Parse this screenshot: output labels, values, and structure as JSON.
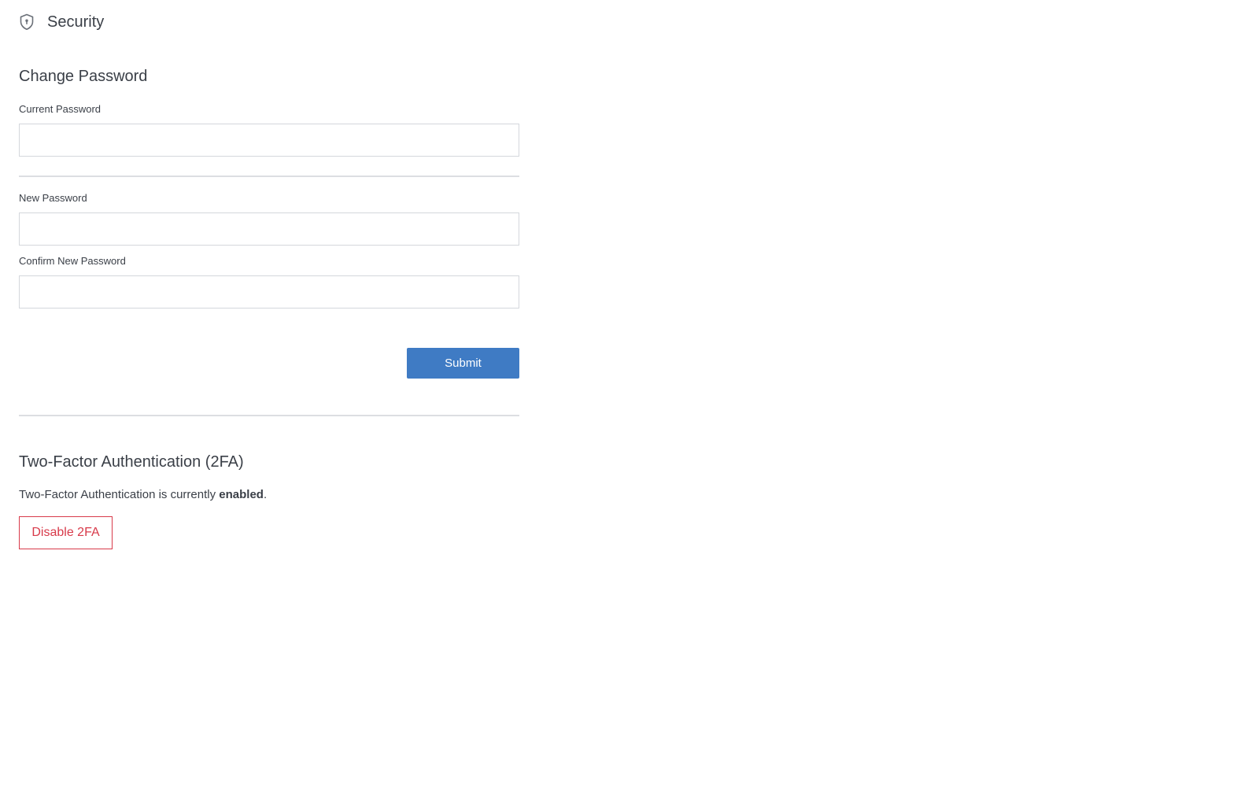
{
  "header": {
    "icon": "shield-icon",
    "title": "Security"
  },
  "change_password": {
    "title": "Change Password",
    "current_password": {
      "label": "Current Password",
      "value": "",
      "placeholder": ""
    },
    "new_password": {
      "label": "New Password",
      "value": "",
      "placeholder": ""
    },
    "confirm_password": {
      "label": "Confirm New Password",
      "value": "",
      "placeholder": ""
    },
    "submit_label": "Submit"
  },
  "two_factor": {
    "title": "Two-Factor Authentication (2FA)",
    "status_prefix": "Two-Factor Authentication is currently ",
    "status_value": "enabled",
    "status_suffix": ".",
    "disable_label": "Disable 2FA"
  },
  "colors": {
    "primary": "#3f7bc4",
    "danger": "#d83a4a",
    "text": "#3a3f47",
    "border": "#d4d7dc"
  }
}
